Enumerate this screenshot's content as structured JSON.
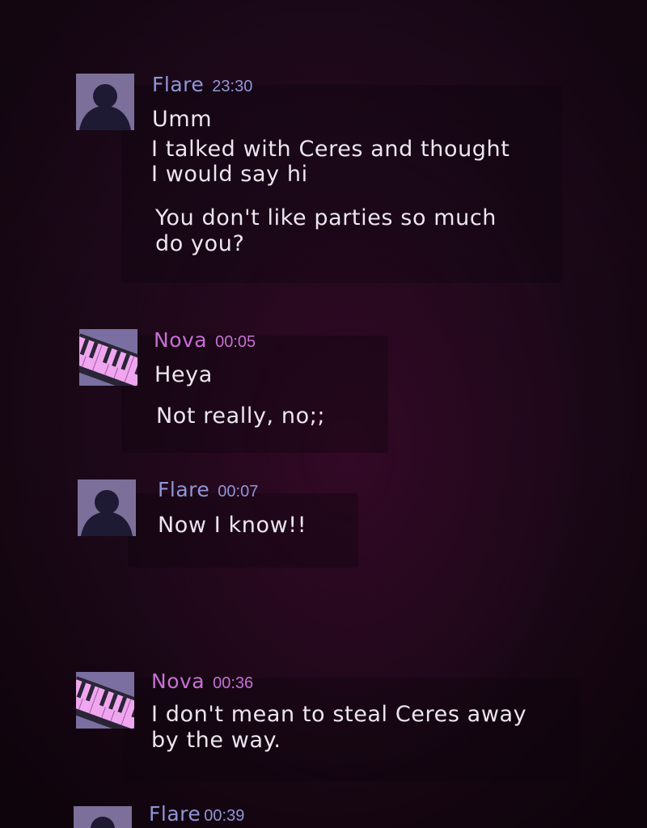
{
  "colors": {
    "flare_name": "#8f96d6",
    "nova_name": "#c86fd6",
    "message_text": "#ece6ee",
    "background": "#1c0818"
  },
  "messages": [
    {
      "author": "Flare",
      "time": "23:30",
      "avatar": "silhouette-avatar",
      "lines": [
        "Umm",
        "I talked with Ceres and thought",
        "I would say hi",
        "You don't like parties so much",
        "do you?"
      ]
    },
    {
      "author": "Nova",
      "time": "00:05",
      "avatar": "piano-keys-avatar",
      "lines": [
        "Heya",
        "Not really, no;;"
      ]
    },
    {
      "author": "Flare",
      "time": "00:07",
      "avatar": "silhouette-avatar",
      "lines": [
        "Now I know!!"
      ]
    },
    {
      "author": "Nova",
      "time": "00:36",
      "avatar": "piano-keys-avatar",
      "lines": [
        "I don't mean to steal Ceres away",
        "by the way."
      ]
    },
    {
      "author": "Flare",
      "time": "00:39",
      "avatar": "silhouette-avatar",
      "lines": []
    }
  ]
}
